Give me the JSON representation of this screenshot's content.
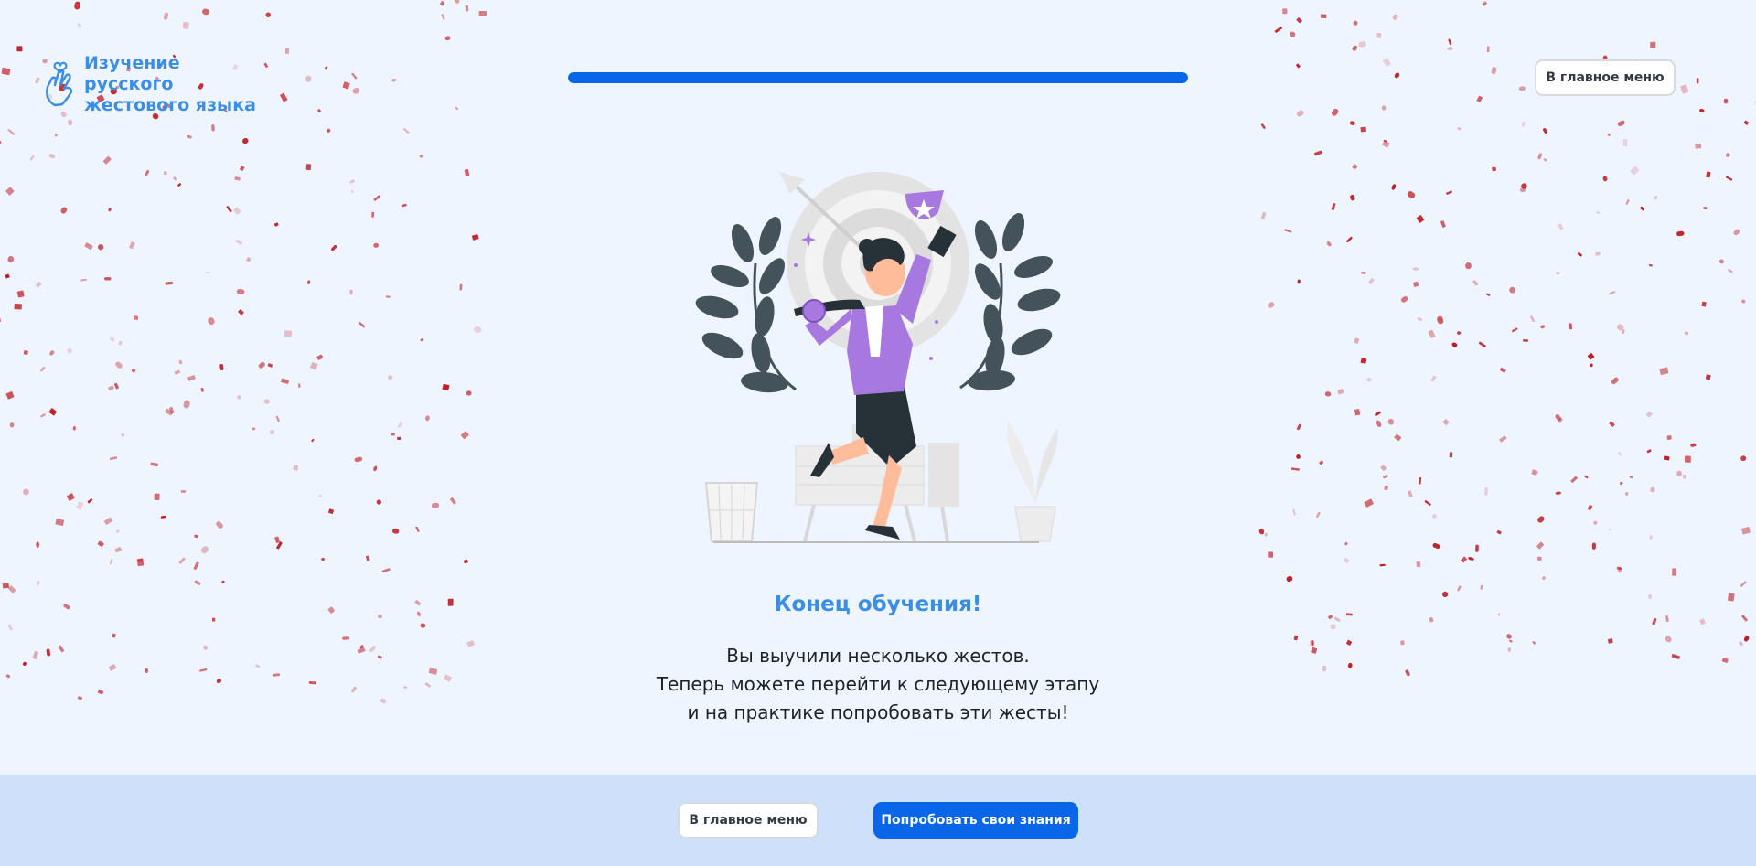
{
  "header": {
    "logo_text": "Изучение русского жестового языка",
    "logo_icon": "hand-heart-icon",
    "menu_button_label": "В главное меню"
  },
  "progress": {
    "value": 1.0
  },
  "result": {
    "title": "Конец обучения!",
    "lines": [
      "Вы выучили несколько жестов.",
      "Теперь можете перейти к следующему этапу",
      "и на практике попробовать эти жесты!"
    ]
  },
  "footer": {
    "menu_button_label": "В главное меню",
    "try_button_label": "Попробовать свои знания"
  },
  "colors": {
    "accent": "#0a66e8",
    "title": "#3a8ee6",
    "background": "#eff5fe",
    "footer_background": "#cfe0fb",
    "confetti": "#c01c24"
  }
}
